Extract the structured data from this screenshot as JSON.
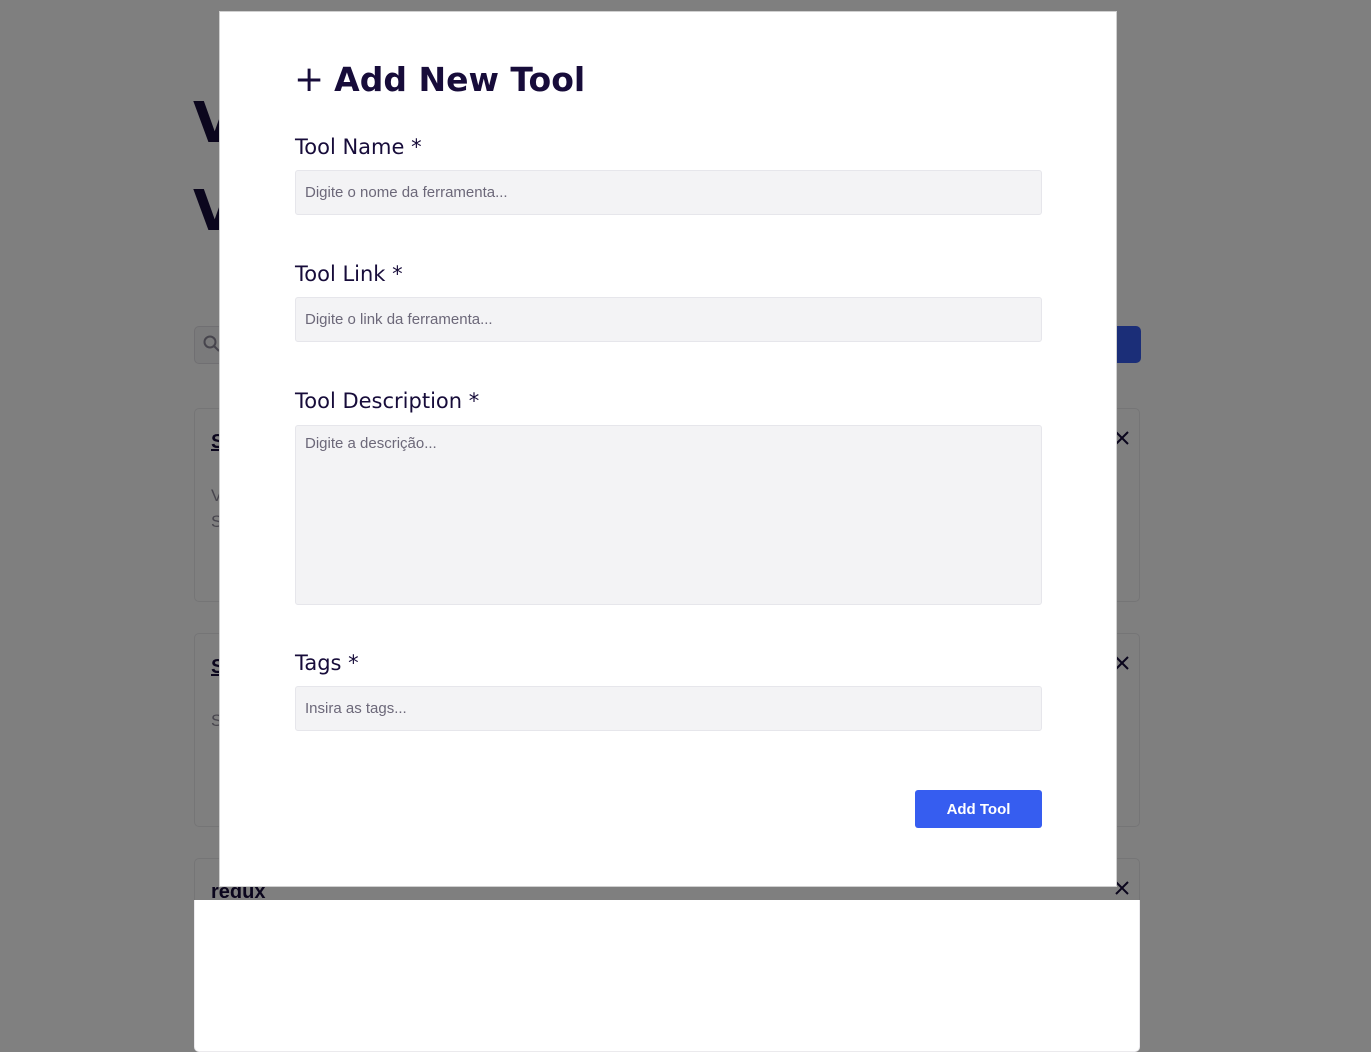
{
  "background": {
    "title_line1": "V",
    "title_line2": "V",
    "cards": [
      {
        "title": "S",
        "description": "V\nS"
      },
      {
        "title": "S",
        "description": "S"
      },
      {
        "title": "redux",
        "description": ""
      }
    ],
    "colors": {
      "accent": "#365df0",
      "heading": "#170c3a",
      "overlay": "rgba(0,0,0,0.5)"
    }
  },
  "modal": {
    "title_icon": "+",
    "title": "Add New Tool",
    "fields": {
      "name": {
        "label": "Tool Name *",
        "placeholder": "Digite o nome da ferramenta..."
      },
      "link": {
        "label": "Tool Link *",
        "placeholder": "Digite o link da ferramenta..."
      },
      "description": {
        "label": "Tool Description *",
        "placeholder": "Digite a descrição..."
      },
      "tags": {
        "label": "Tags *",
        "placeholder": "Insira as tags..."
      }
    },
    "submit_label": "Add Tool"
  }
}
